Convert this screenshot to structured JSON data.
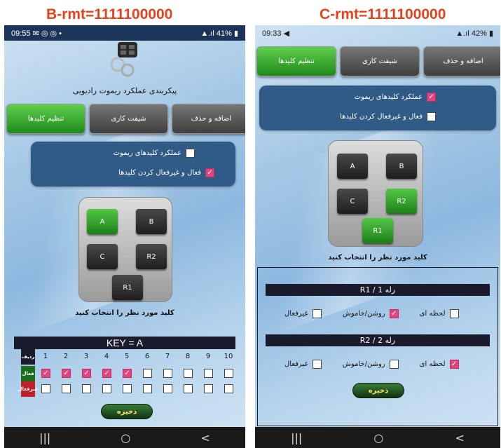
{
  "left": {
    "header": "B-rmt=1111100000",
    "status": {
      "time": "09:55",
      "icons": "✉ ◎ ◎ •",
      "battery": "41%"
    },
    "title": "پیکربندی عملکرد ریموت رادیویی",
    "tabs": [
      "اضافه و حذف",
      "شیفت کاری",
      "تنظیم کلیدها"
    ],
    "options": [
      {
        "label": "عملکرد کلیدهای ریموت",
        "checked": false
      },
      {
        "label": "فعال و غیرفعال کردن کلیدها",
        "checked": true
      }
    ],
    "keys": {
      "a": "A",
      "b": "B",
      "c": "C",
      "r2": "R2",
      "r1": "R1"
    },
    "select_caption": "کلید مورد نظر را انتخاب کنید",
    "key_label": "KEY = A",
    "grid": {
      "row_labels": [
        "ردیف",
        "فعال",
        "غیرفعال"
      ],
      "numbers": [
        "1",
        "2",
        "3",
        "4",
        "5",
        "6",
        "7",
        "8",
        "9",
        "10"
      ],
      "active": [
        true,
        true,
        true,
        true,
        true,
        false,
        false,
        false,
        false,
        false
      ],
      "inactive": [
        false,
        false,
        false,
        false,
        false,
        false,
        false,
        false,
        false,
        false
      ]
    },
    "save": "ذخیره"
  },
  "right": {
    "header": "C-rmt=1111100000",
    "status": {
      "time": "09:33",
      "icons": "◀",
      "battery": "42%"
    },
    "tabs": [
      "اضافه و حذف",
      "شیفت کاری",
      "تنظیم کلیدها"
    ],
    "options": [
      {
        "label": "عملکرد کلیدهای ریموت",
        "checked": true
      },
      {
        "label": "فعال و غیرفعال کردن کلیدها",
        "checked": false
      }
    ],
    "keys": {
      "a": "A",
      "b": "B",
      "c": "C",
      "r2": "R2",
      "r1": "R1"
    },
    "select_caption": "کلید مورد نظر را انتخاب کنید",
    "relays": [
      {
        "title": "R1 / 1 رله",
        "options": [
          {
            "label": "لحظه ای",
            "checked": false
          },
          {
            "label": "روشن/خاموش",
            "checked": true
          },
          {
            "label": "غیرفعال",
            "checked": false
          }
        ]
      },
      {
        "title": "R2 / 2 رله",
        "options": [
          {
            "label": "لحظه ای",
            "checked": true
          },
          {
            "label": "روشن/خاموش",
            "checked": false
          },
          {
            "label": "غیرفعال",
            "checked": false
          }
        ]
      }
    ],
    "save": "ذخیره"
  },
  "nav": {
    "recents": "|||",
    "home": "○",
    "back": "<"
  },
  "colors": {
    "header_red": "#e8401b",
    "active_green": "#1f8a1c",
    "check_pink": "#e0457e",
    "panel_blue": "#2f5b86"
  }
}
